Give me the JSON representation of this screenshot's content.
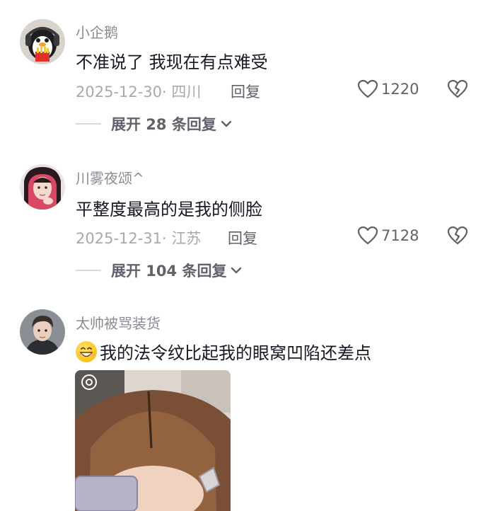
{
  "comments": [
    {
      "username": "小企鹅",
      "text": "不准说了 我现在有点难受",
      "meta": "2025-12-30· 四川",
      "reply_label": "回复",
      "likes": "1220",
      "expand_label": "展开 28 条回复"
    },
    {
      "username": "川雾夜颂^",
      "text": "平整度最高的是我的侧脸",
      "meta": "2025-12-31· 江苏",
      "reply_label": "回复",
      "likes": "7128",
      "expand_label": "展开 104 条回复"
    },
    {
      "username": "太帅被骂装货",
      "text": "我的法令纹比起我的眼窝凹陷还差点"
    }
  ],
  "icons": {
    "like": "heart-outline-icon",
    "dislike": "broken-heart-icon",
    "expand": "chevron-down-icon"
  },
  "colors": {
    "username": "#8a8b91",
    "meta": "#a8a9ae",
    "text": "#161823"
  }
}
